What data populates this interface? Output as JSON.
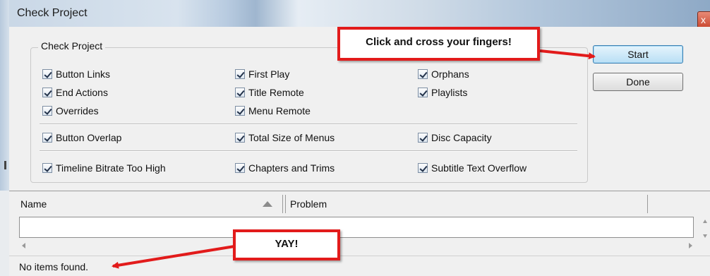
{
  "window": {
    "title": "Check Project",
    "close_glyph": "x"
  },
  "group": {
    "label": "Check Project",
    "row1": [
      "Button Links",
      "First Play",
      "Orphans"
    ],
    "row2": [
      "End Actions",
      "Title Remote",
      "Playlists"
    ],
    "row3": [
      "Overrides",
      "Menu Remote"
    ],
    "row4": [
      "Button Overlap",
      "Total Size of Menus",
      "Disc Capacity"
    ],
    "row5": [
      "Timeline Bitrate Too High",
      "Chapters and Trims",
      "Subtitle Text Overflow"
    ]
  },
  "buttons": {
    "start": "Start",
    "done": "Done"
  },
  "results": {
    "columns": [
      "Name",
      "Problem"
    ],
    "status": "No items found."
  },
  "annotations": {
    "callout_top": "Click and cross your fingers!",
    "callout_bottom": "YAY!",
    "color": "#e21b1b"
  },
  "colors": {
    "accent_button": "#b9dff5",
    "titlebar": "#c9d7e6"
  }
}
